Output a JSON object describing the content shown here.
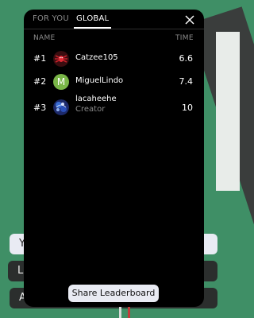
{
  "tabs": [
    {
      "label": "FOR YOU",
      "active": false
    },
    {
      "label": "GLOBAL",
      "active": true
    }
  ],
  "columns": {
    "name": "NAME",
    "time": "TIME"
  },
  "rows": [
    {
      "rank": "#1",
      "name": "Catzee105",
      "sub": "",
      "time": "6.6",
      "avatar": "spider-avatar-icon"
    },
    {
      "rank": "#2",
      "name": "MiguelLindo",
      "sub": "",
      "time": "7.4",
      "avatar_letter": "M",
      "avatar_color": "#7ab648"
    },
    {
      "rank": "#3",
      "name": "lacaheehe",
      "sub": "Creator",
      "time": "10",
      "avatar": "blue-artwork-avatar-icon"
    }
  ],
  "share_label": "Share Leaderboard",
  "background_buttons": [
    {
      "label": "Y"
    },
    {
      "label": "L"
    },
    {
      "label": "A"
    }
  ],
  "colors": {
    "background": "#3f8f66",
    "panel": "#000000",
    "muted_text": "#8a8a8a"
  }
}
